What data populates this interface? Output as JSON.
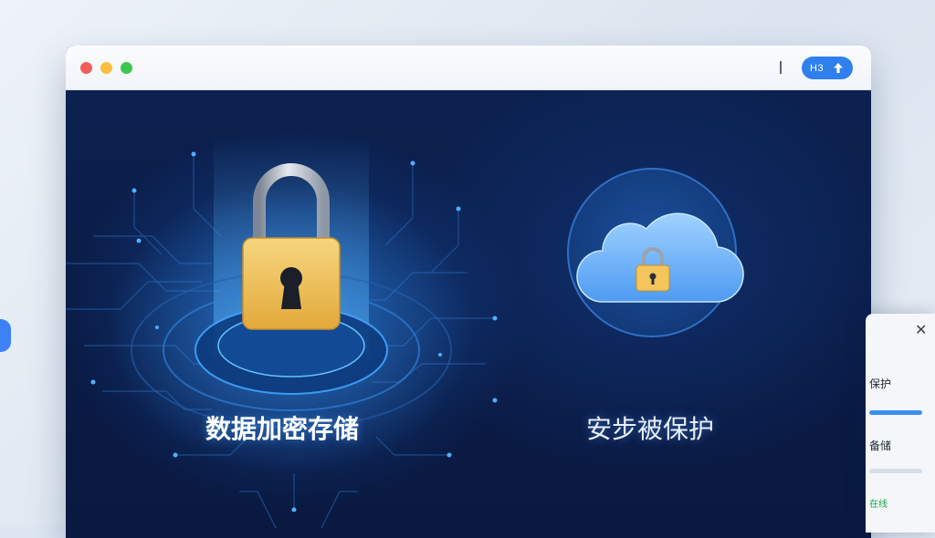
{
  "window": {
    "toolbar": {
      "pill_text": "H3",
      "pill_icon": "upload-arrow-icon"
    }
  },
  "features": {
    "left": {
      "label": "数据加密存储",
      "icon": "padlock-icon"
    },
    "right": {
      "label": "安步被保护",
      "icon": "cloud-lock-icon"
    }
  },
  "side_panel": {
    "close_icon": "close-icon",
    "item1": "保护",
    "item1_progress": 1.0,
    "item2": "备储",
    "item2_progress": 0.0,
    "item3": "在线"
  },
  "colors": {
    "accent": "#2f80ed",
    "window_bg": "#0b1d46",
    "lock_gold": "#f0c560"
  }
}
